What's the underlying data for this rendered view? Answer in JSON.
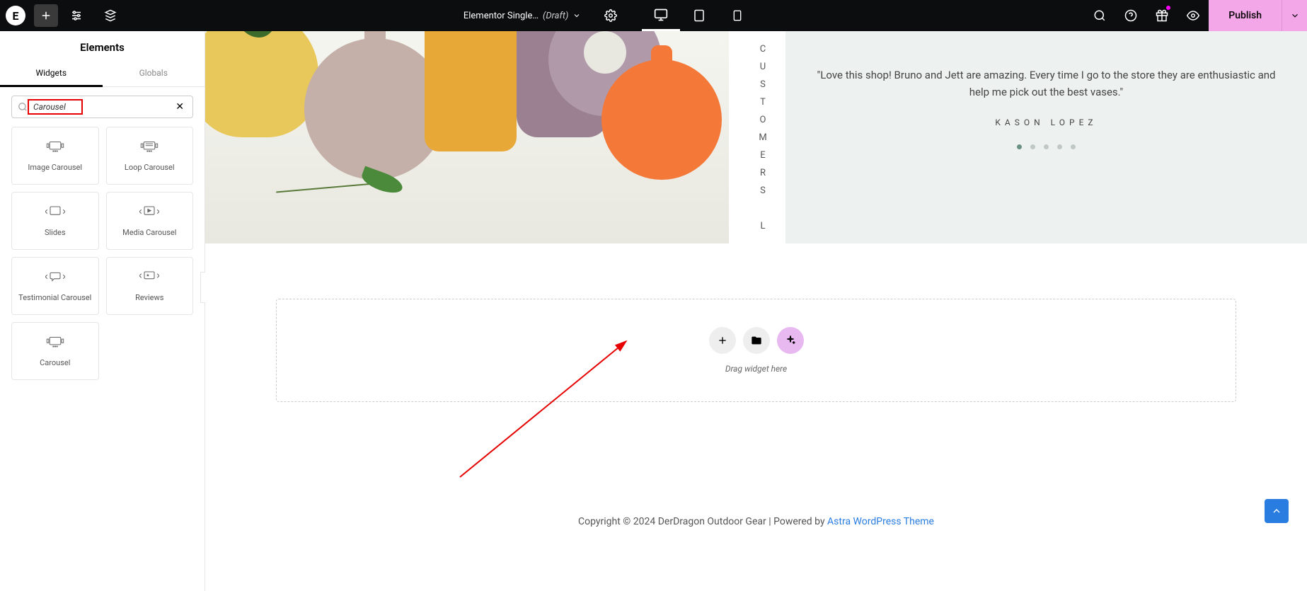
{
  "topbar": {
    "doc_title": "Elementor Single…",
    "doc_status": "(Draft)",
    "publish_label": "Publish"
  },
  "sidebar": {
    "header": "Elements",
    "tabs": {
      "widgets": "Widgets",
      "globals": "Globals"
    },
    "search_value": "Carousel",
    "widgets": [
      "Image Carousel",
      "Loop Carousel",
      "Slides",
      "Media Carousel",
      "Testimonial Carousel",
      "Reviews",
      "Carousel"
    ]
  },
  "canvas": {
    "side_label": "CUSTOMERS L",
    "testimonial": {
      "text": "\"Love this shop! Bruno and Jett are amazing. Every time I go to the store they are enthusiastic and help me pick out the best vases.\"",
      "author": "KASON LOPEZ"
    },
    "dropzone_text": "Drag widget here",
    "footer_text": "Copyright © 2024 DerDragon Outdoor Gear | Powered by ",
    "footer_link": "Astra WordPress Theme"
  }
}
